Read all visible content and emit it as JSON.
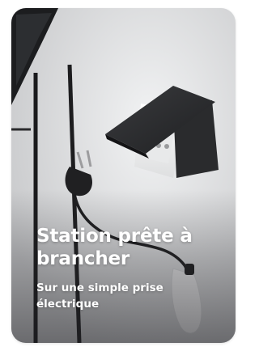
{
  "card": {
    "title": "Station prête à brancher",
    "subtitle": "Sur une simple prise électrique",
    "image": {
      "description_icon": "wall-socket-with-plug-photo",
      "colors": {
        "background": "#d9dadc",
        "socket_cover": "#2b2c2f",
        "socket_face": "#f4f4f5",
        "cable": "#1e1e20",
        "text": "#ffffff"
      }
    }
  }
}
